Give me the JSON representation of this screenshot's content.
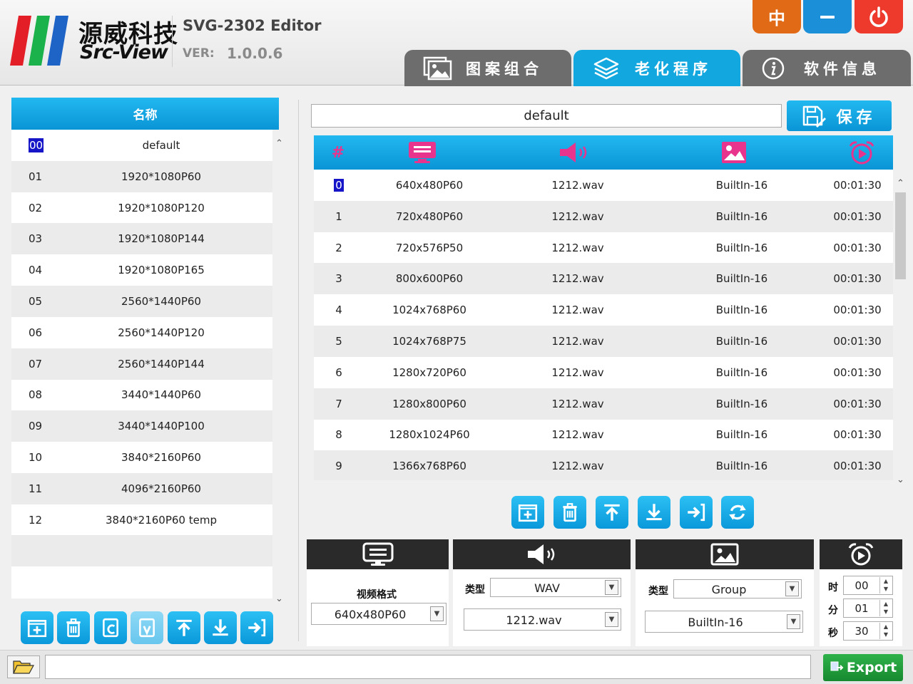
{
  "brand": {
    "cn": "源威科技",
    "en": "Src-View"
  },
  "app": {
    "title": "SVG-2302 Editor",
    "ver_label": "VER:",
    "ver_value": "1.0.0.6"
  },
  "window_buttons": {
    "lang": "中"
  },
  "tabs": [
    {
      "label": "图案组合",
      "icon": "image-gallery-icon",
      "active": false
    },
    {
      "label": "老化程序",
      "icon": "layers-icon",
      "active": true
    },
    {
      "label": "软件信息",
      "icon": "info-icon",
      "active": false
    }
  ],
  "left": {
    "header": "名称",
    "rows": [
      {
        "idx": "00",
        "name": "default",
        "selected": true
      },
      {
        "idx": "01",
        "name": "1920*1080P60"
      },
      {
        "idx": "02",
        "name": "1920*1080P120"
      },
      {
        "idx": "03",
        "name": "1920*1080P144"
      },
      {
        "idx": "04",
        "name": "1920*1080P165"
      },
      {
        "idx": "05",
        "name": "2560*1440P60"
      },
      {
        "idx": "06",
        "name": "2560*1440P120"
      },
      {
        "idx": "07",
        "name": "2560*1440P144"
      },
      {
        "idx": "08",
        "name": "3440*1440P60"
      },
      {
        "idx": "09",
        "name": "3440*1440P100"
      },
      {
        "idx": "10",
        "name": "3840*2160P60"
      },
      {
        "idx": "11",
        "name": "4096*2160P60"
      },
      {
        "idx": "12",
        "name": "3840*2160P60 temp"
      }
    ]
  },
  "program": {
    "name_value": "default",
    "save_label": "保存",
    "hash_header": "#",
    "rows": [
      {
        "n": "0",
        "fmt": "640x480P60",
        "audio": "1212.wav",
        "pattern": "BuiltIn-16",
        "time": "00:01:30",
        "selected": true
      },
      {
        "n": "1",
        "fmt": "720x480P60",
        "audio": "1212.wav",
        "pattern": "BuiltIn-16",
        "time": "00:01:30"
      },
      {
        "n": "2",
        "fmt": "720x576P50",
        "audio": "1212.wav",
        "pattern": "BuiltIn-16",
        "time": "00:01:30"
      },
      {
        "n": "3",
        "fmt": "800x600P60",
        "audio": "1212.wav",
        "pattern": "BuiltIn-16",
        "time": "00:01:30"
      },
      {
        "n": "4",
        "fmt": "1024x768P60",
        "audio": "1212.wav",
        "pattern": "BuiltIn-16",
        "time": "00:01:30"
      },
      {
        "n": "5",
        "fmt": "1024x768P75",
        "audio": "1212.wav",
        "pattern": "BuiltIn-16",
        "time": "00:01:30"
      },
      {
        "n": "6",
        "fmt": "1280x720P60",
        "audio": "1212.wav",
        "pattern": "BuiltIn-16",
        "time": "00:01:30"
      },
      {
        "n": "7",
        "fmt": "1280x800P60",
        "audio": "1212.wav",
        "pattern": "BuiltIn-16",
        "time": "00:01:30"
      },
      {
        "n": "8",
        "fmt": "1280x1024P60",
        "audio": "1212.wav",
        "pattern": "BuiltIn-16",
        "time": "00:01:30"
      },
      {
        "n": "9",
        "fmt": "1366x768P60",
        "audio": "1212.wav",
        "pattern": "BuiltIn-16",
        "time": "00:01:30"
      }
    ]
  },
  "config": {
    "video": {
      "label": "视频格式",
      "value": "640x480P60"
    },
    "audio": {
      "type_label": "类型",
      "type_value": "WAV",
      "file_value": "1212.wav"
    },
    "pattern": {
      "type_label": "类型",
      "type_value": "Group",
      "file_value": "BuiltIn-16"
    },
    "time": {
      "h_label": "时",
      "h": "00",
      "m_label": "分",
      "m": "01",
      "s_label": "秒",
      "s": "30"
    }
  },
  "footer": {
    "path_value": "",
    "export_label": "Export"
  },
  "colors": {
    "accent": "#12a7de",
    "tab_inactive": "#6d6d6d",
    "lang": "#e06a16",
    "minimize": "#1b8fd8",
    "close": "#ee3a2c",
    "export": "#22a03c",
    "header_icon": "#e8348c"
  }
}
